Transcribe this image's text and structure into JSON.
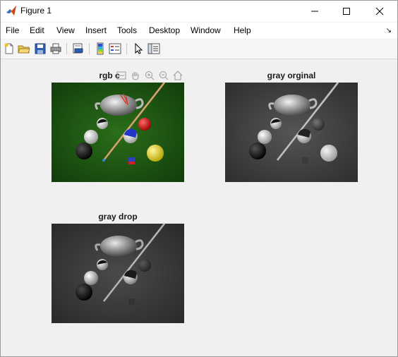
{
  "window": {
    "title": "Figure 1"
  },
  "menu": [
    "File",
    "Edit",
    "View",
    "Insert",
    "Tools",
    "Desktop",
    "Window",
    "Help"
  ],
  "plots": [
    {
      "title": "rgb c",
      "image": "color billiards scene"
    },
    {
      "title": "gray orginal",
      "image": "grayscale billiards scene"
    },
    {
      "title": "gray drop",
      "image": "darkened grayscale billiards scene"
    }
  ],
  "colors": {
    "felt": "#1f5a12",
    "gray_bg": "#4a4a4a",
    "gray_dark": "#3b3b3b"
  }
}
